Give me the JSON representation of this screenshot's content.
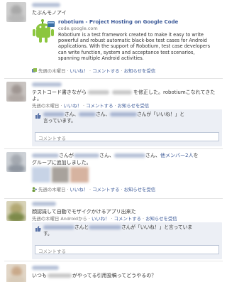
{
  "posts": [
    {
      "text": "たぶんモノアイ",
      "attachment": {
        "title": "robotium - Project Hosting on Google Code",
        "domain": "code.google.com",
        "description_lines": [
          "Robotium is a test framework created to make it easy to write",
          "powerful and robust automatic black-box test cases for Android",
          "applications. With the support of Robotium, test case developers",
          "can write function, system and acceptance test scenarios,",
          "spanning multiple Android activities."
        ]
      },
      "meta": {
        "time": "先週の木曜日",
        "like": "いいね！",
        "comment": "コメントする",
        "subscribe": "お知らせを受信",
        "sep": " · "
      }
    },
    {
      "text_before": "テストコード書きながら",
      "text_mid": "を修正した。",
      "text_after": "robotiumこなれてきた",
      "text_line2": "よ。",
      "meta": {
        "time": "先週の木曜日",
        "like": "いいね！",
        "comment": "コメントする",
        "subscribe": "お知らせを受信",
        "sep": " · "
      },
      "likes": {
        "san1": "さん、",
        "san2": "さん、",
        "tail": "さんが「いいね！」と",
        "line2": "言っています。"
      },
      "comment_placeholder": "コメントする"
    },
    {
      "text_a": "さんが",
      "text_b": "さん、",
      "text_c": "さん、",
      "others_link": "他メンバー2人",
      "text_d": "を",
      "line2": "グループに追加しました。",
      "meta": {
        "time": "先週の木曜日",
        "like": "いいね！",
        "comment": "コメントする",
        "subscribe": "お知らせを受信",
        "sep": " · "
      }
    },
    {
      "text": "顔認識して自動でモザイクかけるアプリ出来た",
      "meta": {
        "time": "先週の木曜日",
        "via": "Androidから",
        "like": "いいね！",
        "comment": "コメントする",
        "subscribe": "お知らせを受信",
        "sep": " · "
      },
      "likes": {
        "san1": "さんと",
        "tail": "さんが「いいね！」と言っていま",
        "line2": "す。"
      },
      "comment_placeholder": "コメントする"
    },
    {
      "text_before": "いつも",
      "text_after": "がやってる引用投稿ってどうやるの？"
    }
  ],
  "colors": {
    "link": "#3b5998",
    "meta_text": "#777777",
    "like_box": "#eceff5",
    "separator": "#e5e5e5",
    "input_border": "#bdc7d8"
  },
  "icons": {
    "attachment_thumb": "robot-icon",
    "like": "thumbs-up-icon",
    "share_source": "external-app-icon",
    "group": "group-add-icon"
  }
}
